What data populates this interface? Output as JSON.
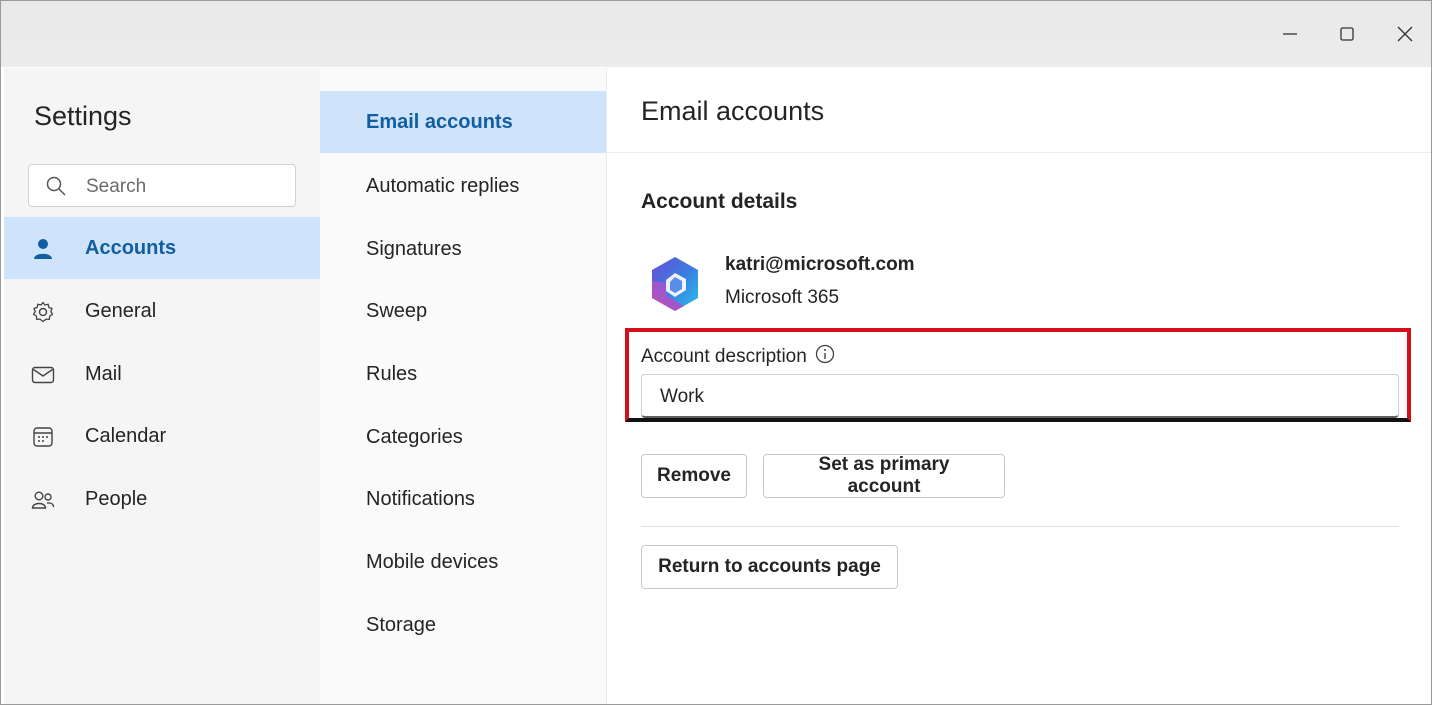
{
  "window": {
    "controls": {
      "minimize_icon": "minimize-icon",
      "maximize_icon": "maximize-icon",
      "close_icon": "close-icon"
    }
  },
  "sidebar": {
    "title": "Settings",
    "search_placeholder": "Search",
    "items": [
      {
        "label": "Accounts",
        "icon": "person-icon",
        "active": true
      },
      {
        "label": "General",
        "icon": "gear-icon",
        "active": false
      },
      {
        "label": "Mail",
        "icon": "mail-icon",
        "active": false
      },
      {
        "label": "Calendar",
        "icon": "calendar-icon",
        "active": false
      },
      {
        "label": "People",
        "icon": "people-icon",
        "active": false
      }
    ]
  },
  "subnav": {
    "items": [
      {
        "label": "Email accounts",
        "active": true
      },
      {
        "label": "Automatic replies"
      },
      {
        "label": "Signatures"
      },
      {
        "label": "Sweep"
      },
      {
        "label": "Rules"
      },
      {
        "label": "Categories"
      },
      {
        "label": "Notifications"
      },
      {
        "label": "Mobile devices"
      },
      {
        "label": "Storage"
      }
    ]
  },
  "content": {
    "title": "Email accounts",
    "section_title": "Account details",
    "account": {
      "email": "katri@microsoft.com",
      "type": "Microsoft 365",
      "logo": "microsoft-365-logo-icon"
    },
    "description_label": "Account description",
    "description_value": "Work",
    "buttons": {
      "remove": "Remove",
      "set_primary": "Set as primary account",
      "return": "Return to accounts page"
    }
  },
  "colors": {
    "accent": "#115ea3",
    "selection": "#cfe4fa",
    "highlight": "#d20f1b"
  }
}
